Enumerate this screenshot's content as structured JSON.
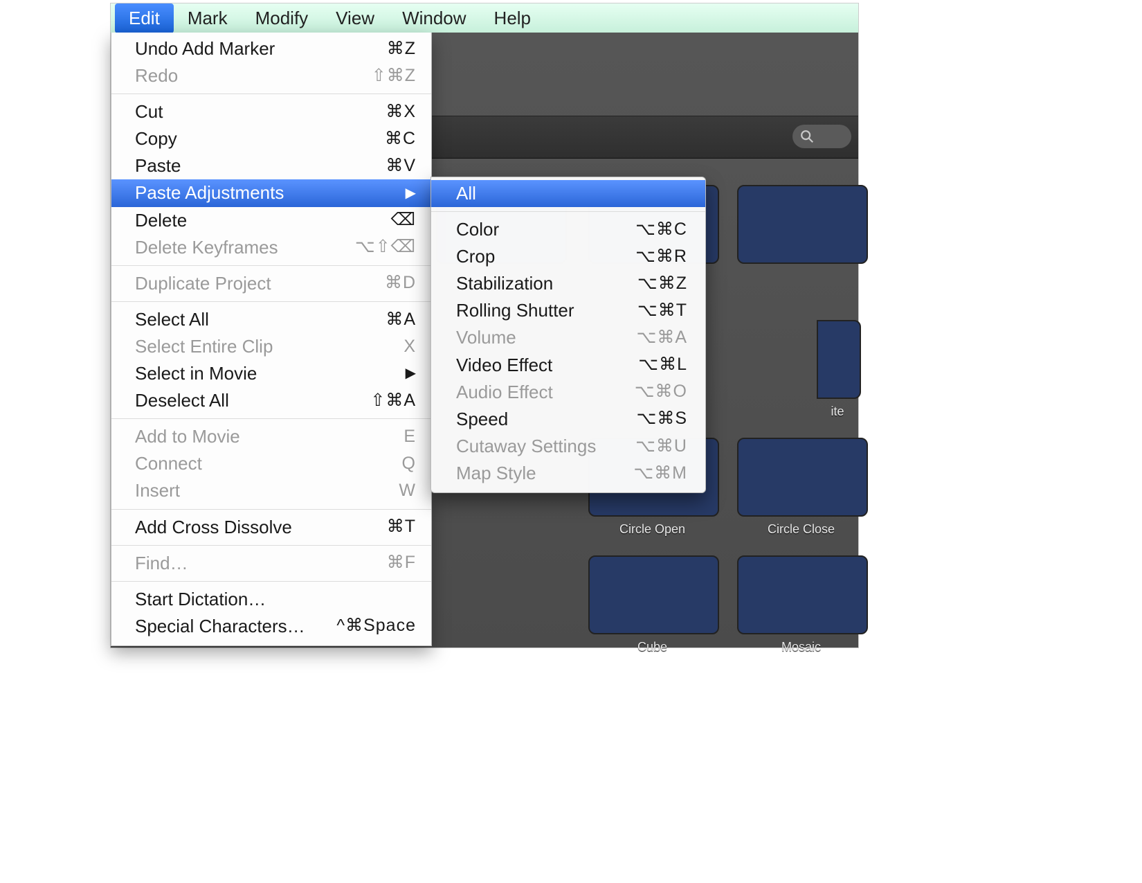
{
  "menubar": {
    "items": [
      {
        "label": "Edit",
        "active": true
      },
      {
        "label": "Mark"
      },
      {
        "label": "Modify"
      },
      {
        "label": "View"
      },
      {
        "label": "Window"
      },
      {
        "label": "Help"
      }
    ]
  },
  "editMenu": {
    "groups": [
      [
        {
          "label": "Undo Add Marker",
          "shortcut": "⌘Z"
        },
        {
          "label": "Redo",
          "shortcut": "⇧⌘Z",
          "disabled": true
        }
      ],
      [
        {
          "label": "Cut",
          "shortcut": "⌘X"
        },
        {
          "label": "Copy",
          "shortcut": "⌘C"
        },
        {
          "label": "Paste",
          "shortcut": "⌘V"
        },
        {
          "label": "Paste Adjustments",
          "submenu": true,
          "highlight": true
        },
        {
          "label": "Delete",
          "shortcut": "⌫"
        },
        {
          "label": "Delete Keyframes",
          "shortcut": "⌥⇧⌫",
          "disabled": true
        }
      ],
      [
        {
          "label": "Duplicate Project",
          "shortcut": "⌘D",
          "disabled": true
        }
      ],
      [
        {
          "label": "Select All",
          "shortcut": "⌘A"
        },
        {
          "label": "Select Entire Clip",
          "shortcut": "X",
          "disabled": true
        },
        {
          "label": "Select in Movie",
          "submenu": true
        },
        {
          "label": "Deselect All",
          "shortcut": "⇧⌘A"
        }
      ],
      [
        {
          "label": "Add to Movie",
          "shortcut": "E",
          "disabled": true
        },
        {
          "label": "Connect",
          "shortcut": "Q",
          "disabled": true
        },
        {
          "label": "Insert",
          "shortcut": "W",
          "disabled": true
        }
      ],
      [
        {
          "label": "Add Cross Dissolve",
          "shortcut": "⌘T"
        }
      ],
      [
        {
          "label": "Find…",
          "shortcut": "⌘F",
          "disabled": true
        }
      ],
      [
        {
          "label": "Start Dictation…"
        },
        {
          "label": "Special Characters…",
          "shortcut": "^⌘Space"
        }
      ]
    ]
  },
  "pasteAdjustmentsSubmenu": {
    "groups": [
      [
        {
          "label": "All",
          "highlight": true
        }
      ],
      [
        {
          "label": "Color",
          "shortcut": "⌥⌘C"
        },
        {
          "label": "Crop",
          "shortcut": "⌥⌘R"
        },
        {
          "label": "Stabilization",
          "shortcut": "⌥⌘Z"
        },
        {
          "label": "Rolling Shutter",
          "shortcut": "⌥⌘T"
        },
        {
          "label": "Volume",
          "shortcut": "⌥⌘A",
          "disabled": true
        },
        {
          "label": "Video Effect",
          "shortcut": "⌥⌘L"
        },
        {
          "label": "Audio Effect",
          "shortcut": "⌥⌘O",
          "disabled": true
        },
        {
          "label": "Speed",
          "shortcut": "⌥⌘S"
        },
        {
          "label": "Cutaway Settings",
          "shortcut": "⌥⌘U",
          "disabled": true
        },
        {
          "label": "Map Style",
          "shortcut": "⌥⌘M",
          "disabled": true
        }
      ]
    ]
  },
  "thumbnails": {
    "row1": [
      {
        "label": ""
      },
      {
        "label": ""
      },
      {
        "label": ""
      }
    ],
    "row2_partial_label": "ite",
    "row3": [
      {
        "label": "Circle Open"
      },
      {
        "label": "Circle Close"
      }
    ],
    "row4": [
      {
        "label": "Cube"
      },
      {
        "label": "Mosaic"
      }
    ]
  },
  "search": {
    "placeholder": ""
  }
}
